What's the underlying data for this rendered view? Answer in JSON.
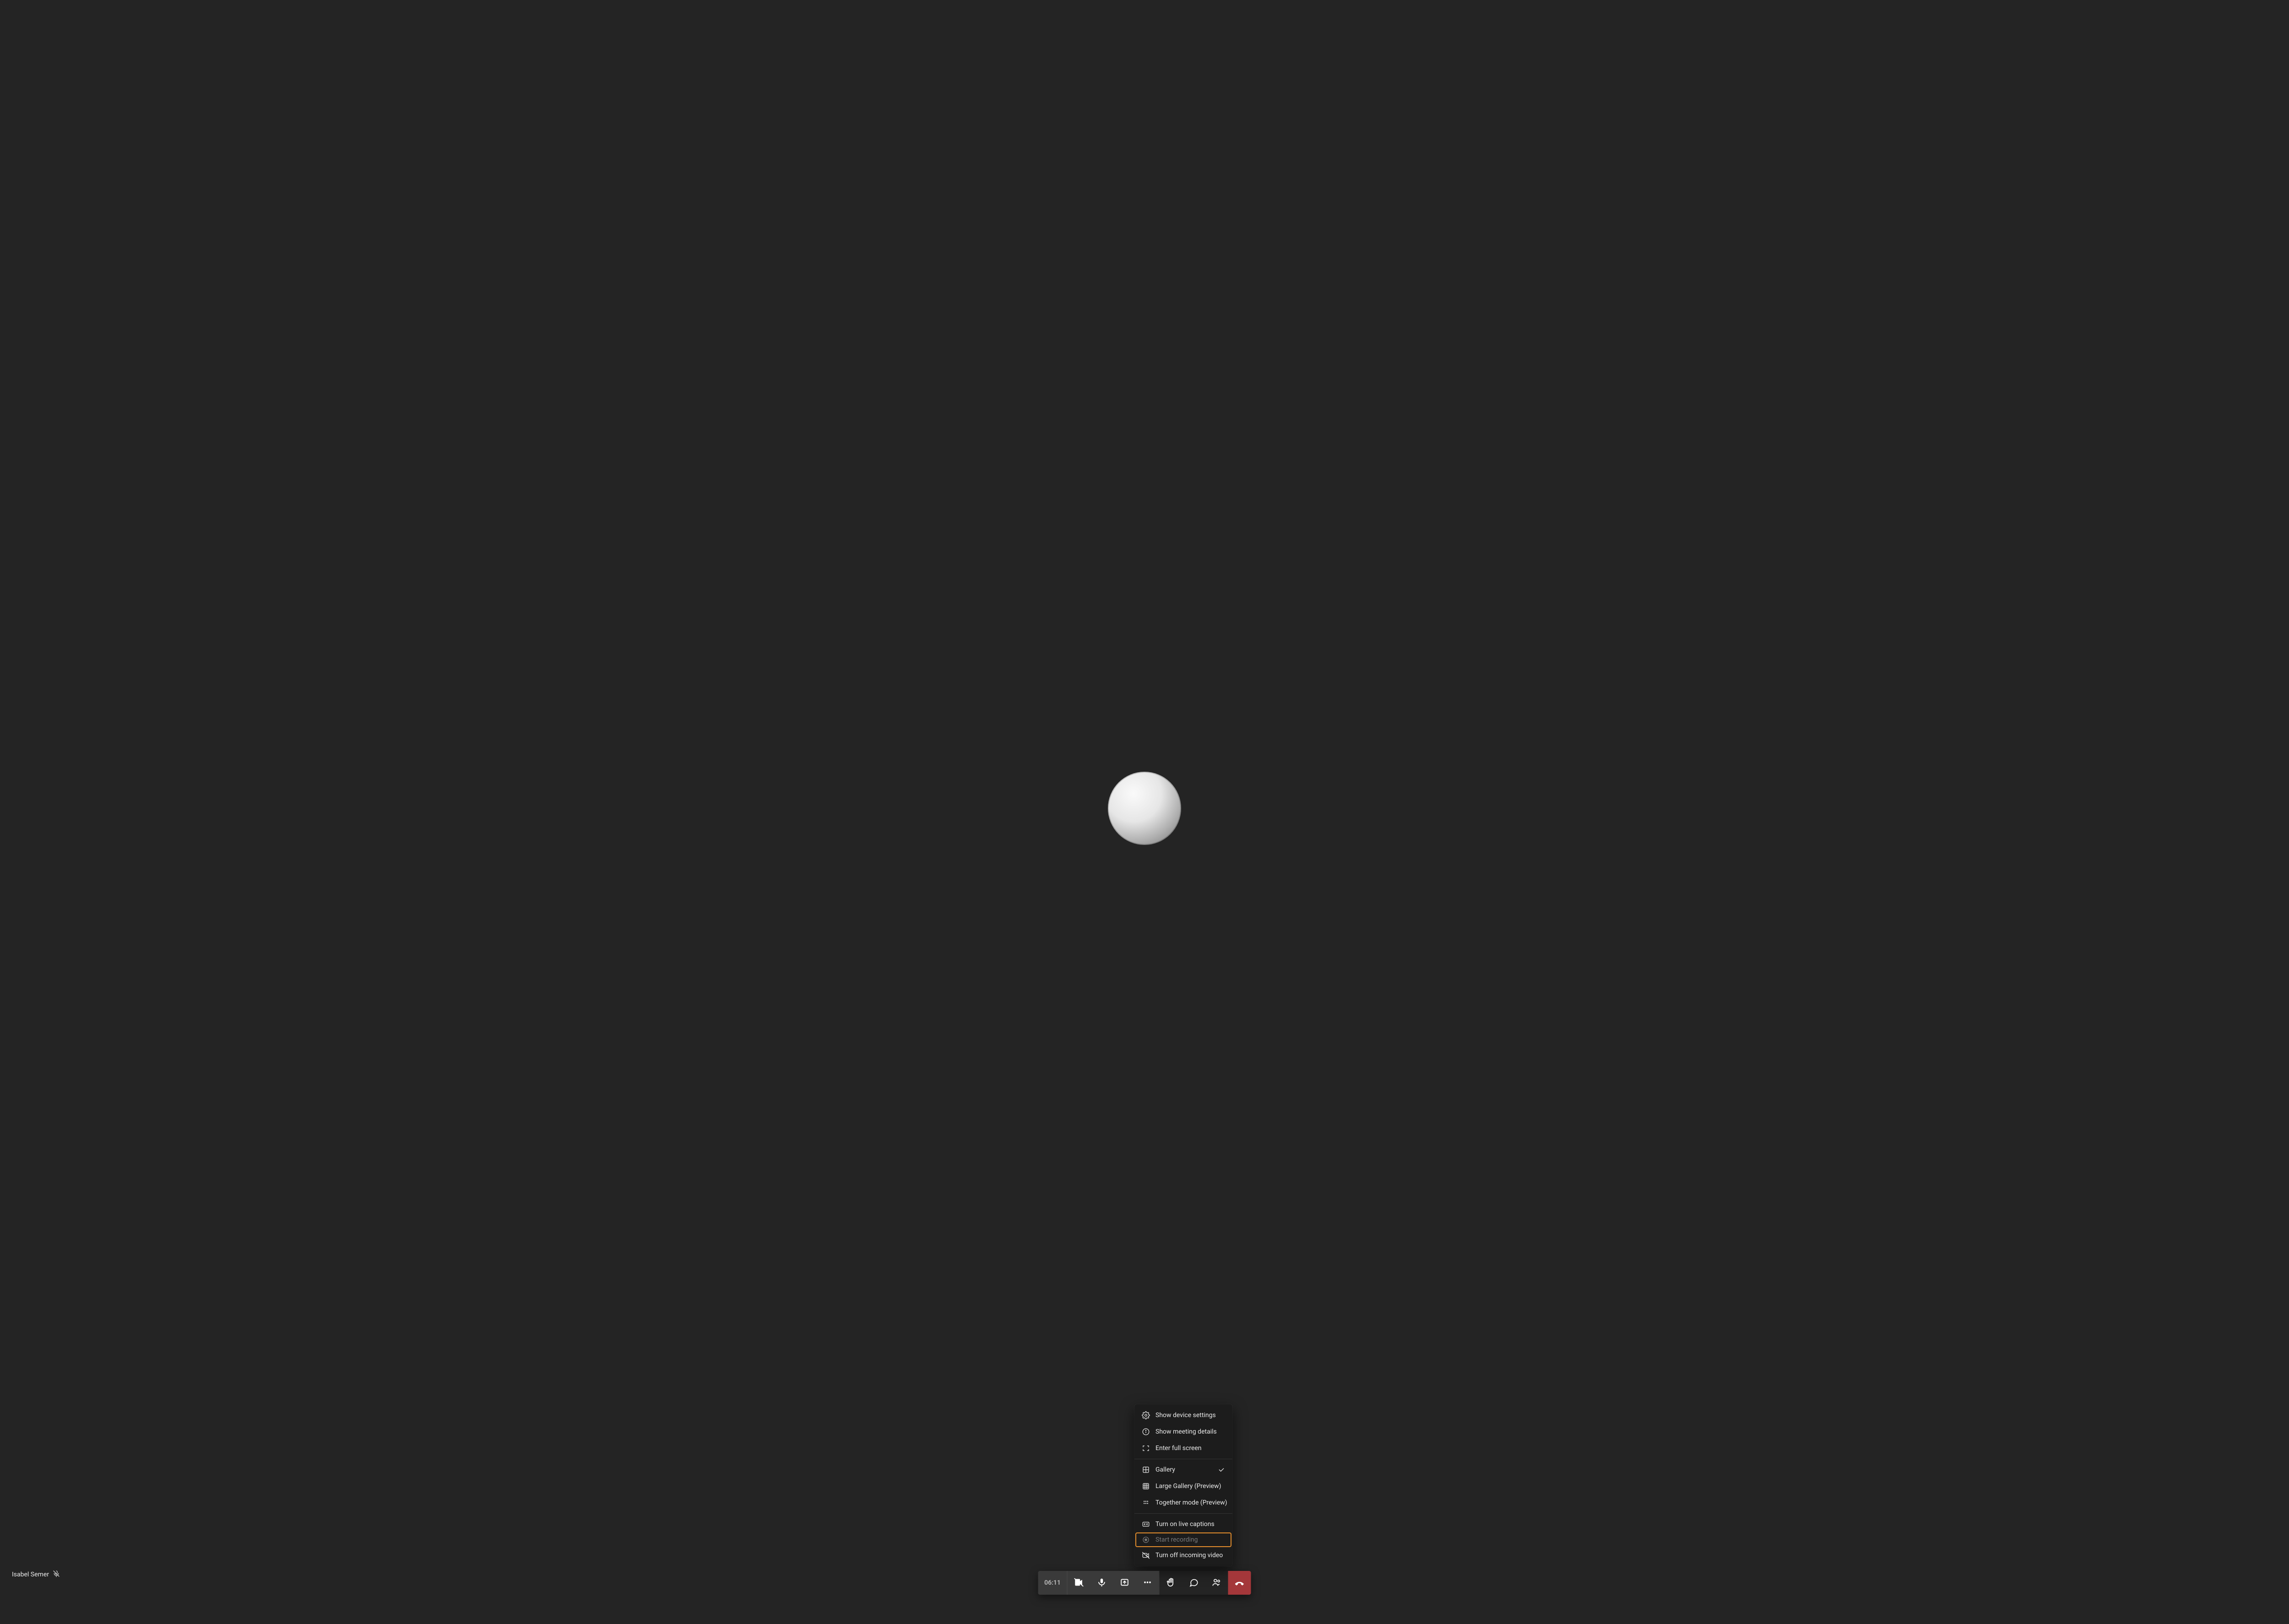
{
  "participant": {
    "name": "Isabel Semer",
    "muted": true
  },
  "toolbar": {
    "timer": "06:11"
  },
  "menu": {
    "show_device_settings": "Show device settings",
    "show_meeting_details": "Show meeting details",
    "enter_full_screen": "Enter full screen",
    "gallery": "Gallery",
    "large_gallery": "Large Gallery (Preview)",
    "together_mode": "Together mode (Preview)",
    "turn_on_captions": "Turn on live captions",
    "start_recording": "Start recording",
    "turn_off_incoming_video": "Turn off incoming video"
  }
}
